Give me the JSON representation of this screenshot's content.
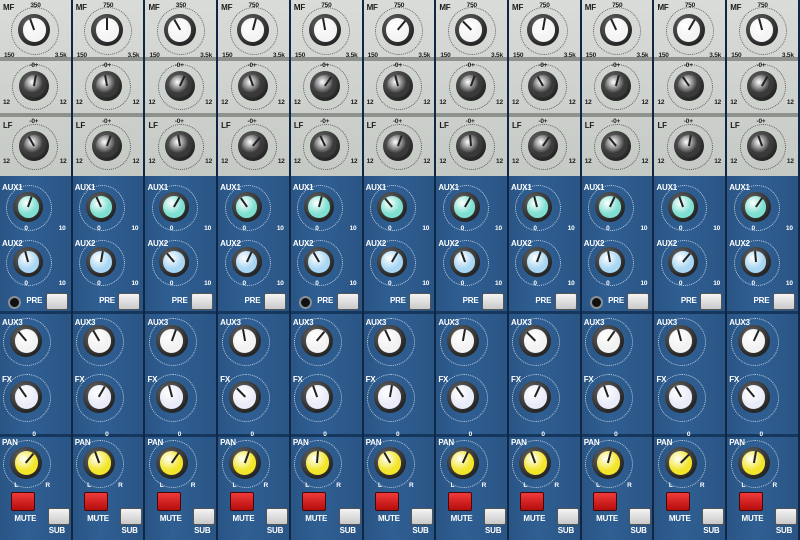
{
  "channel_count": 11,
  "labels": {
    "mf": "MF",
    "lf": "LF",
    "aux1": "AUX1",
    "aux2": "AUX2",
    "aux3": "AUX3",
    "fx": "FX",
    "pan": "PAN",
    "pre": "PRE",
    "mute": "MUTE",
    "sub": "SUB",
    "freq_top": "750",
    "freq_top_alt": "350",
    "freq_left": "150",
    "freq_right": "3.5k",
    "gain_center": "-0+",
    "gain_left": "12",
    "gain_right": "12",
    "send_min": "0",
    "send_max": "10",
    "pan_center": "0",
    "pan_left": "L",
    "pan_right": "R"
  },
  "colors": {
    "top_panel": "#cfd3ce",
    "blue_panel": "#2c5a8c",
    "aux1_cap": "#7fe0d2",
    "aux2_cap": "#a9d6f2",
    "aux3_cap": "#f2f2f2",
    "fx_cap": "#e9ecf8",
    "pan_cap": "#f2e52a",
    "mute_button": "#d91e1e",
    "white_button": "#e8e8e8"
  }
}
